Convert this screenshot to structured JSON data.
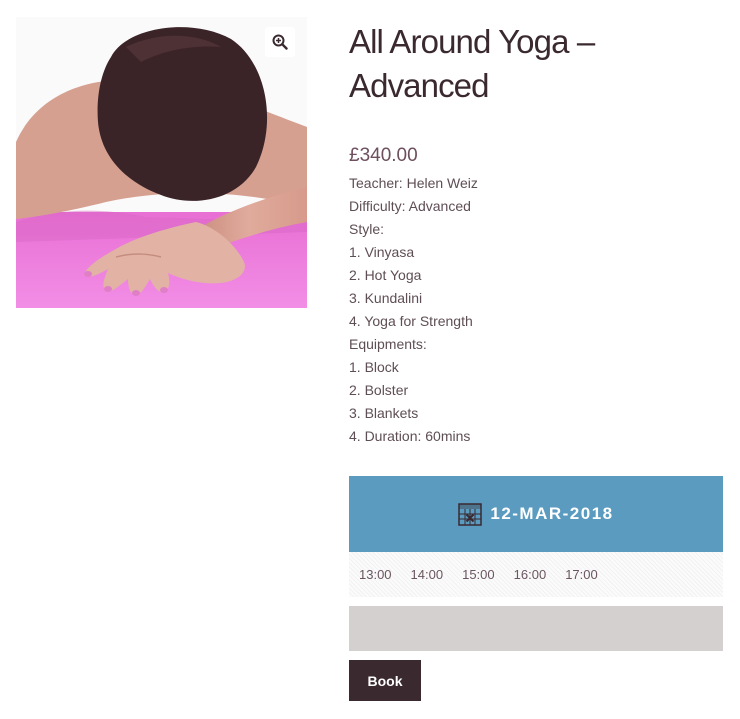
{
  "product": {
    "title_line1": "All Around Yoga –",
    "title_line2": "Advanced",
    "price": "£340.00",
    "description": [
      "Teacher: Helen Weiz",
      "Difficulty: Advanced",
      "Style:",
      "1. Vinyasa",
      "2. Hot Yoga",
      "3. Kundalini",
      "4. Yoga for Strength",
      "Equipments:",
      "1. Block",
      "2. Bolster",
      "3. Blankets",
      "4. Duration: 60mins"
    ]
  },
  "gallery": {
    "zoom_icon": "magnifier-plus-icon"
  },
  "booking": {
    "date": "12-MAR-2018",
    "calendar_icon": "calendar-icon",
    "slots": [
      "13:00",
      "14:00",
      "15:00",
      "16:00",
      "17:00"
    ],
    "book_label": "Book"
  },
  "colors": {
    "accent": "#5a9bbf",
    "button": "#3a2a30",
    "selection_bar": "#d5d0d0",
    "mat": "#f07ee0"
  }
}
